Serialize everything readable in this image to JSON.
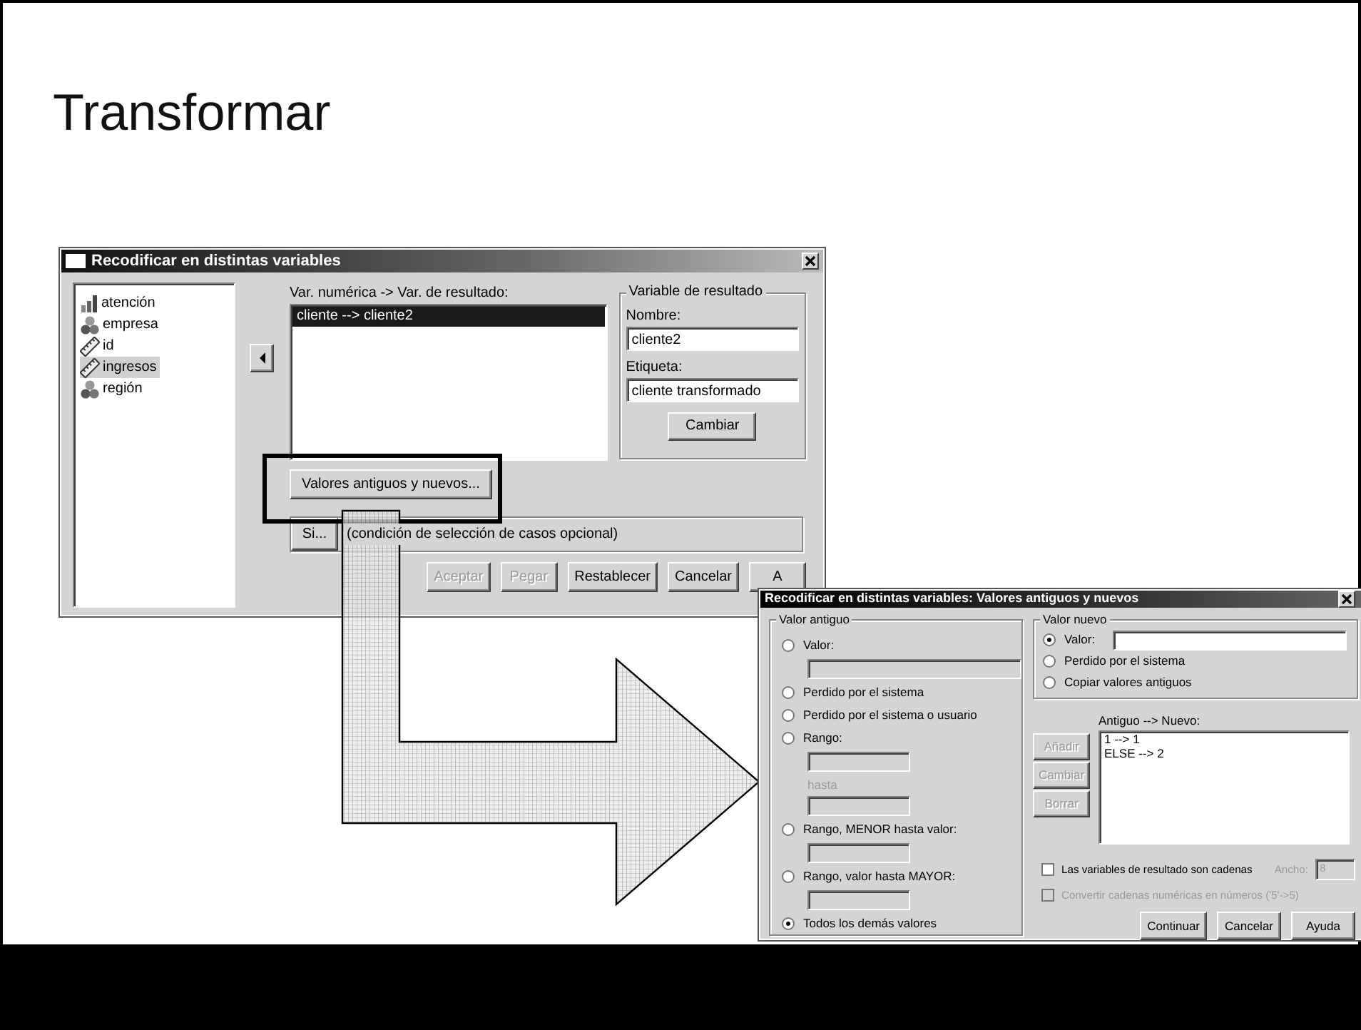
{
  "slide": {
    "title": "Transformar"
  },
  "dialog1": {
    "title": "Recodificar en distintas variables",
    "variables": [
      {
        "name": "atención",
        "kind": "ordinal",
        "selected": false
      },
      {
        "name": "empresa",
        "kind": "nominal",
        "selected": false
      },
      {
        "name": "id",
        "kind": "scale",
        "selected": false
      },
      {
        "name": "ingresos",
        "kind": "scale",
        "selected": true
      },
      {
        "name": "región",
        "kind": "nominal",
        "selected": false
      }
    ],
    "mapping_label": "Var. numérica -> Var. de resultado:",
    "mappings": [
      {
        "text": "cliente --> cliente2",
        "selected": true
      }
    ],
    "output_group": {
      "legend": "Variable de resultado",
      "name_label": "Nombre:",
      "name_value": "cliente2",
      "label_label": "Etiqueta:",
      "label_value": "cliente transformado",
      "change_button": "Cambiar"
    },
    "old_new_button": "Valores antiguos y nuevos...",
    "if_button": "Si...",
    "if_note": "(condición de selección de casos opcional)",
    "buttons": [
      {
        "label": "Aceptar",
        "disabled": true
      },
      {
        "label": "Pegar",
        "disabled": true
      },
      {
        "label": "Restablecer",
        "disabled": false
      },
      {
        "label": "Cancelar",
        "disabled": false
      },
      {
        "label": "A",
        "disabled": false
      }
    ]
  },
  "dialog2": {
    "title": "Recodificar en distintas variables: Valores antiguos y nuevos",
    "old_value": {
      "legend": "Valor antiguo",
      "items": [
        {
          "kind": "radio",
          "label": "Valor:",
          "selected": false
        },
        {
          "kind": "field",
          "disabled": true
        },
        {
          "kind": "radio",
          "label": "Perdido por el sistema",
          "selected": false
        },
        {
          "kind": "radio",
          "label": "Perdido por el sistema o usuario",
          "selected": false
        },
        {
          "kind": "radio",
          "label": "Rango:",
          "selected": false
        },
        {
          "kind": "field",
          "disabled": true
        },
        {
          "kind": "label",
          "label": "hasta",
          "disabled": true
        },
        {
          "kind": "field",
          "disabled": true
        },
        {
          "kind": "radio",
          "label": "Rango, MENOR hasta valor:",
          "selected": false
        },
        {
          "kind": "field",
          "disabled": true
        },
        {
          "kind": "radio",
          "label": "Rango, valor hasta MAYOR:",
          "selected": false
        },
        {
          "kind": "field",
          "disabled": true
        },
        {
          "kind": "radio",
          "label": "Todos los demás valores",
          "selected": true
        }
      ]
    },
    "new_value": {
      "legend": "Valor nuevo",
      "options": [
        {
          "label": "Valor:",
          "selected": true,
          "has_field": true
        },
        {
          "label": "Perdido por el sistema",
          "selected": false,
          "has_field": false
        },
        {
          "label": "Copiar valores antiguos",
          "selected": false,
          "has_field": false
        }
      ]
    },
    "list_label": "Antiguo --> Nuevo:",
    "list_buttons": [
      {
        "label": "Añadir",
        "disabled": true
      },
      {
        "label": "Cambiar",
        "disabled": true
      },
      {
        "label": "Borrar",
        "disabled": true
      }
    ],
    "list_items": [
      "1 --> 1",
      "ELSE --> 2"
    ],
    "checkboxes": [
      {
        "label": "Las variables de resultado son cadenas",
        "checked": false,
        "disabled": false,
        "width_label": "Ancho:",
        "width_value": "8"
      },
      {
        "label": "Convertir cadenas numéricas en números ('5'->5)",
        "checked": false,
        "disabled": true
      }
    ],
    "buttons": [
      {
        "label": "Continuar"
      },
      {
        "label": "Cancelar"
      },
      {
        "label": "Ayuda"
      }
    ]
  }
}
